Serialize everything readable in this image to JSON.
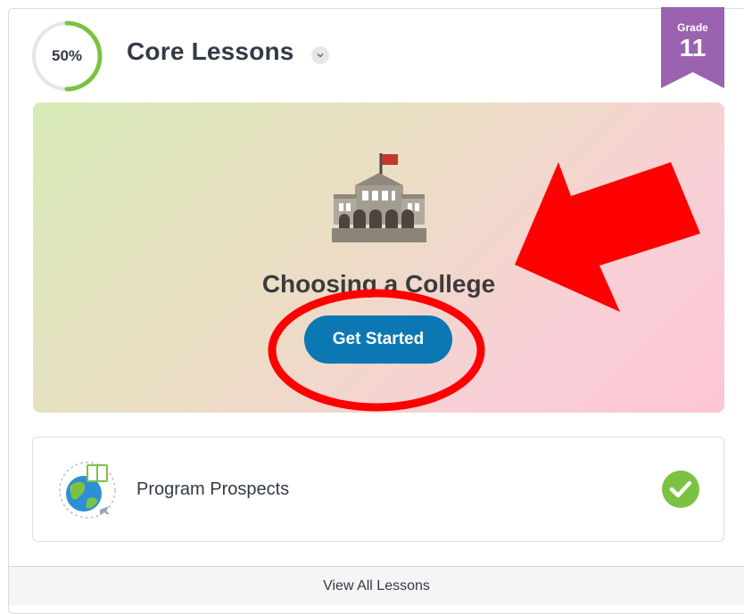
{
  "progress": {
    "label": "50%",
    "value": 0.5,
    "color": "#7cc242"
  },
  "header": {
    "title": "Core Lessons",
    "expand_icon": "chevron-down-icon"
  },
  "grade_badge": {
    "label": "Grade",
    "number": "11",
    "color": "#9b62b0"
  },
  "featured_lesson": {
    "icon": "college-building-icon",
    "title": "Choosing a College",
    "button_label": "Get Started",
    "button_color": "#0c78b3"
  },
  "annotations": {
    "color": "#ff0000",
    "shapes": [
      "arrow",
      "ellipse"
    ]
  },
  "lessons": [
    {
      "icon": "globe-book-icon",
      "label": "Program Prospects",
      "status_icon": "checkmark-icon",
      "completed": true
    }
  ],
  "footer": {
    "link_label": "View All Lessons"
  }
}
